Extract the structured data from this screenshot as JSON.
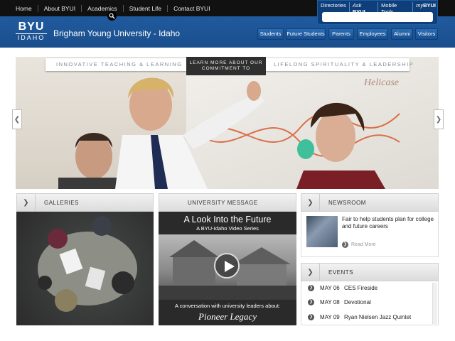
{
  "topnav": [
    "Home",
    "About BYUI",
    "Academics",
    "Student Life",
    "Contact BYUI"
  ],
  "utility": {
    "links": [
      {
        "pre": "",
        "strong": "",
        "text": "Directories"
      },
      {
        "pre": "Ask ",
        "strong": "BYUI",
        "text": ""
      },
      {
        "pre": "",
        "strong": "",
        "text": "Mobile Tools"
      },
      {
        "pre": "my",
        "strong": "BYUI",
        "text": ""
      }
    ],
    "search_placeholder": ""
  },
  "logo": {
    "line1": "BYU",
    "line2": "IDAHO"
  },
  "site_title": "Brigham Young University - Idaho",
  "audience": [
    "Students",
    "Future Students",
    "Parents",
    "Employees",
    "Alumni",
    "Visitors"
  ],
  "hero": {
    "left_text": "INNOVATIVE TEACHING & LEARNING",
    "center_text": "LEARN MORE ABOUT OUR COMMITMENT TO",
    "right_text": "LIFELONG SPIRITUALITY & LEADERSHIP",
    "board_text": "Helicase"
  },
  "panels": {
    "galleries": "GALLERIES",
    "university_message": "UNIVERSITY MESSAGE",
    "newsroom": "NEWSROOM",
    "events": "EVENTS"
  },
  "video": {
    "title": "A Look Into the Future",
    "subtitle": "A BYU-Idaho Video Series",
    "caption": "A conversation with university leaders about:",
    "name": "Pioneer Legacy"
  },
  "news": {
    "headline": "Fair to help students plan for college and future careers",
    "read_more": "Read More"
  },
  "events": [
    {
      "date": "MAY 06",
      "name": "CES Fireside"
    },
    {
      "date": "MAY 08",
      "name": "Devotional"
    },
    {
      "date": "MAY 09",
      "name": "Ryan Nielsen Jazz Quintet"
    }
  ],
  "colors": {
    "brand_blue": "#1a4e8c",
    "top_bar": "#111111",
    "panel_bg": "#e4e4e4"
  }
}
